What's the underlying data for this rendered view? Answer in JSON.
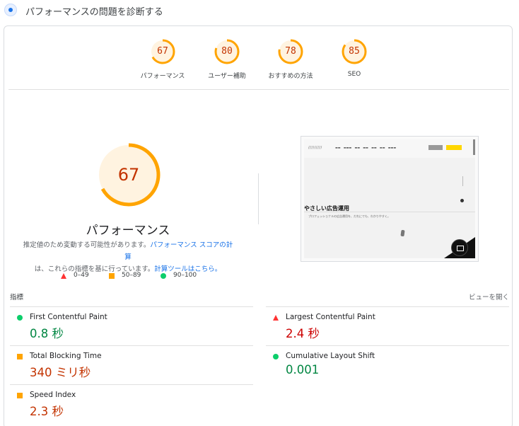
{
  "header": {
    "title": "パフォーマンスの問題を診断する"
  },
  "gauges": [
    {
      "score": "67",
      "label": "パフォーマンス",
      "fraction": 0.67
    },
    {
      "score": "80",
      "label": "ユーザー補助",
      "fraction": 0.8
    },
    {
      "score": "78",
      "label": "おすすめの方法",
      "fraction": 0.78
    },
    {
      "score": "85",
      "label": "SEO",
      "fraction": 0.85
    }
  ],
  "performance": {
    "score": "67",
    "fraction": 0.67,
    "title": "パフォーマンス",
    "desc_1": "推定値のため変動する可能性があります。",
    "desc_link_1": "パフォーマンス スコアの計算",
    "desc_2": "は、これらの指標を基に行っています。",
    "desc_link_2": "計算ツールはこちら。"
  },
  "legend": [
    {
      "shape": "triangle",
      "range": "0–49"
    },
    {
      "shape": "square",
      "range": "50–89"
    },
    {
      "shape": "circle",
      "range": "90–100"
    }
  ],
  "screenshot": {
    "hero_text": "やさしい広告運用",
    "sub_text": "プロフェッショナルの広告運用を、だれにでも、わかりやすく。"
  },
  "metrics_header": {
    "left": "指標",
    "right": "ビューを開く"
  },
  "metrics": [
    {
      "name": "First Contentful Paint",
      "value": "0.8 秒",
      "rating": "good"
    },
    {
      "name": "Largest Contentful Paint",
      "value": "2.4 秒",
      "rating": "poor"
    },
    {
      "name": "Total Blocking Time",
      "value": "340 ミリ秒",
      "rating": "average"
    },
    {
      "name": "Cumulative Layout Shift",
      "value": "0.001",
      "rating": "good"
    },
    {
      "name": "Speed Index",
      "value": "2.3 秒",
      "rating": "average"
    }
  ],
  "colors": {
    "good": "#0cce6b",
    "good_text": "#018642",
    "average": "#ffa400",
    "average_text": "#c33300",
    "poor": "#ff3333",
    "poor_text": "#cc0000",
    "gauge_bg": "#fff3e0",
    "link": "#1a73e8"
  }
}
